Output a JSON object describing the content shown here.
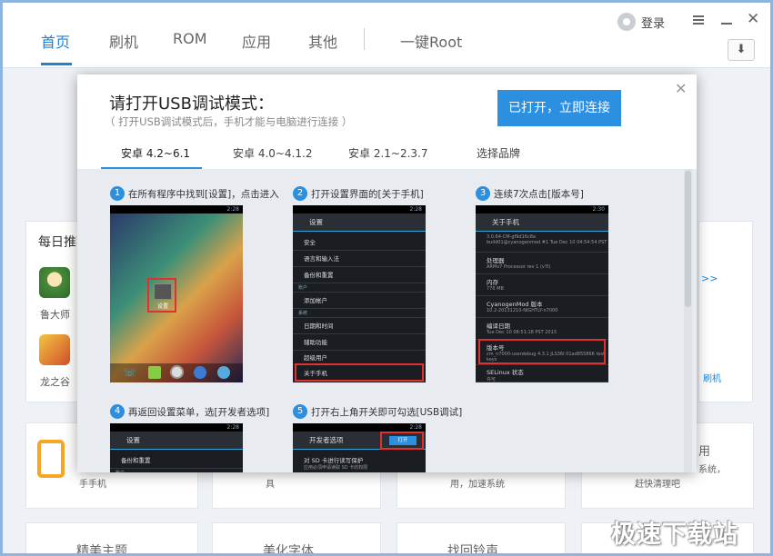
{
  "header": {
    "tabs": [
      "首页",
      "刷机",
      "ROM",
      "应用",
      "其他",
      "一键Root"
    ],
    "login_label": "登录"
  },
  "background": {
    "daily_title": "每日推荐",
    "apps": [
      "鲁大师",
      "龙之谷"
    ],
    "right_label": "刷机",
    "bottom_cards": [
      "手手机",
      "具",
      "用，加速系统",
      "赶快清理吧",
      "用",
      "系统，"
    ],
    "lower_cards": [
      "精美主题",
      "美化字体",
      "找回铃声"
    ],
    "watermark": "极速下载站"
  },
  "dialog": {
    "title": "请打开USB调试模式：",
    "subtitle": "（ 打开USB调试模式后，手机才能与电脑进行连接 ）",
    "connect_button": "已打开，立即连接",
    "tabs": [
      "安卓 4.2~6.1",
      "安卓 4.0~4.1.2",
      "安卓 2.1~2.3.7",
      "选择品牌"
    ],
    "steps": [
      {
        "num": "1",
        "text": "在所有程序中找到[设置]，点击进入"
      },
      {
        "num": "2",
        "text": "打开设置界面的[关于手机]"
      },
      {
        "num": "3",
        "text": "连续7次点击[版本号]"
      },
      {
        "num": "4",
        "text": "再返回设置菜单，选[开发者选项]"
      },
      {
        "num": "5",
        "text": "打开右上角开关即可勾选[USB调试]"
      }
    ],
    "phone2": {
      "time": "2:28",
      "title": "设置",
      "rows": [
        "安全",
        "语言和输入法",
        "备份和重置",
        "账户",
        "添加帐户",
        "系统",
        "日期和时间",
        "辅助功能",
        "超级用户",
        "关于手机"
      ]
    },
    "phone1": {
      "time": "2:28",
      "icon_label": "设置"
    },
    "phone3": {
      "time": "2:30",
      "title": "关于手机",
      "rows": [
        {
          "h": "3.0.64-CM-gf9d16c8a",
          "s": "build01@cyanogenmod #1 Tue Dec 10 04:54:54 PST 2013"
        },
        {
          "h": "处理器",
          "s": "ARMv7 Processor rev 1 (v7l)"
        },
        {
          "h": "内存",
          "s": "776 MB"
        },
        {
          "h": "CyanogenMod 版本",
          "s": "10.2-20131210-NIGHTLY-n7000"
        },
        {
          "h": "编译日期",
          "s": "Tue Dec 10 08:51:18 PST 2013"
        },
        {
          "h": "版本号",
          "s": "cm_n7000-userdebug 4.3.1 JLS36I 01ad855866 test-keys"
        },
        {
          "h": "SELinux 状态",
          "s": "许可"
        }
      ]
    },
    "phone4": {
      "time": "2:28",
      "title": "设置",
      "rows": [
        "备份和重置",
        "账户"
      ]
    },
    "phone5": {
      "time": "2:28",
      "title": "开发者选项",
      "switch": "打开",
      "rows": [
        {
          "h": "对 SD 卡进行读写保护",
          "s": "应用必须申请读取 SD 卡的权限"
        }
      ]
    }
  }
}
